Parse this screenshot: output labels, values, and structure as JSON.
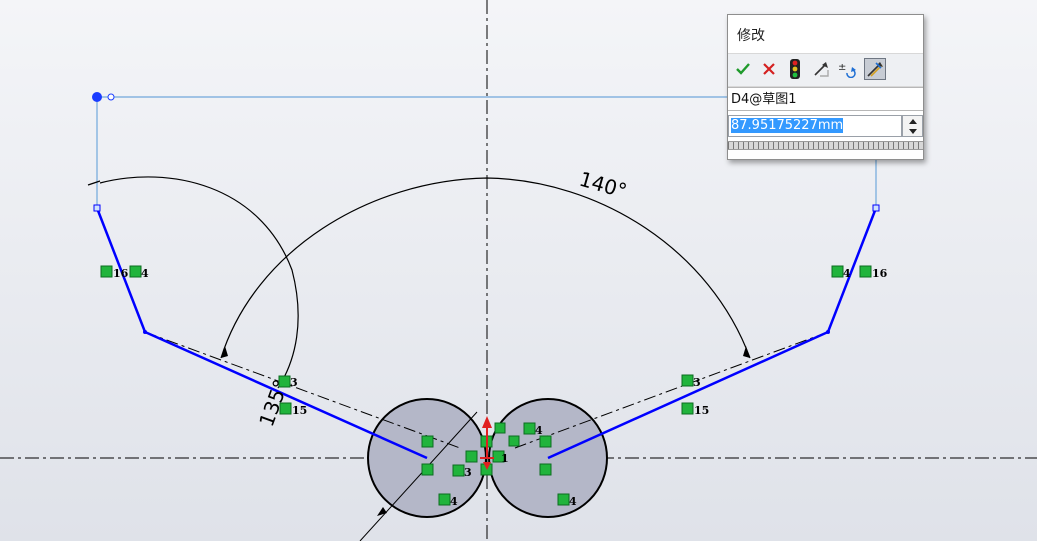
{
  "dialog": {
    "title": "修改",
    "dimension_name": "D4@草图1",
    "value": "87.95175227mm",
    "toolbar": [
      {
        "name": "ok-icon",
        "label": "✔"
      },
      {
        "name": "cancel-icon",
        "label": "✕"
      },
      {
        "name": "rebuild-icon",
        "label": ""
      },
      {
        "name": "reset-icon",
        "label": ""
      },
      {
        "name": "reverse-sense-icon",
        "label": "±"
      },
      {
        "name": "mark-for-drawing-icon",
        "label": ""
      }
    ]
  },
  "sketch": {
    "angle_labels": [
      "140°",
      "135°"
    ],
    "relations": {
      "left_upper": [
        "16",
        "4"
      ],
      "right_upper": [
        "4",
        "16"
      ],
      "left_mid_a": "3",
      "left_mid_b": "15",
      "right_mid_a": "3",
      "right_mid_b": "15",
      "center_a": "4",
      "center_b": "3",
      "center_c": "1",
      "bottom_left": "4",
      "bottom_right": "4"
    },
    "colors": {
      "sketch_line": "#0000ff",
      "construction": "#6fa8dc",
      "circle_fill": "#b4b7c8",
      "relation_icon": "#21b43c",
      "origin": "#e02020"
    }
  }
}
